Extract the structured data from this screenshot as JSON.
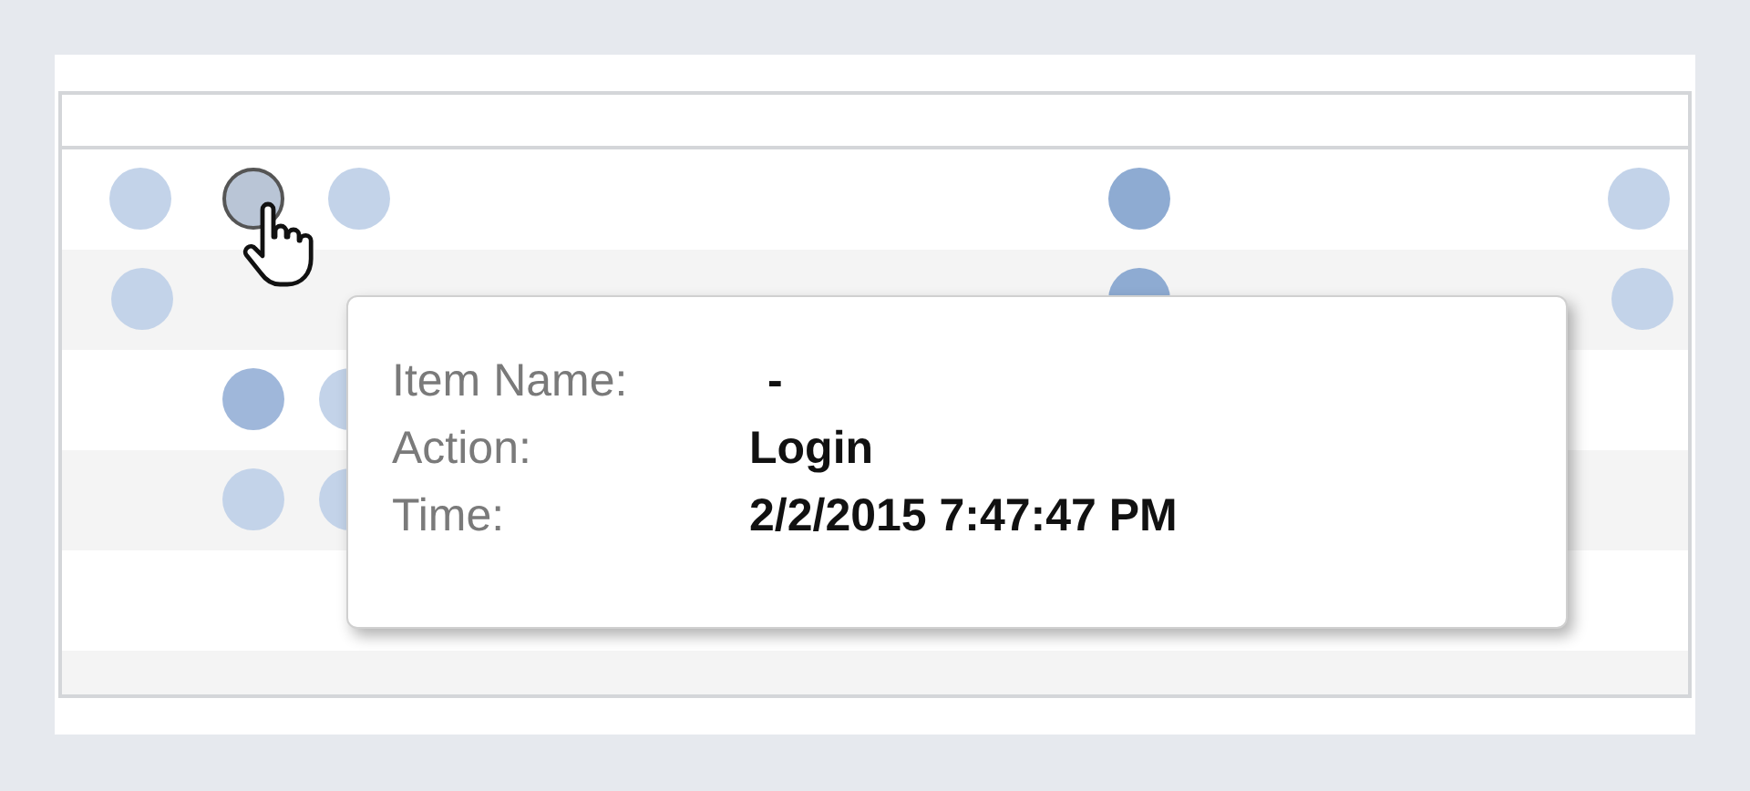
{
  "rows": [
    {
      "dots": [
        {
          "color": "#c3d3e9",
          "selected": false
        },
        {
          "color": "#b9c5d6",
          "selected": true
        },
        {
          "color": "#c3d3e9",
          "selected": false
        },
        {
          "color": "#8eabd2",
          "selected": false
        },
        {
          "color": "#c3d3e9",
          "selected": false
        }
      ]
    },
    {
      "dots": [
        {
          "color": "#c3d3e9",
          "selected": false
        },
        {
          "color": "#8eabd2",
          "selected": false
        },
        {
          "color": "#c3d3e9",
          "selected": false
        }
      ]
    },
    {
      "dots": [
        {
          "color": "#9fb7da",
          "selected": false
        },
        {
          "color": "#c3d3e9",
          "selected": false
        }
      ]
    },
    {
      "dots": [
        {
          "color": "#c3d3e9",
          "selected": false
        },
        {
          "color": "#c3d3e9",
          "selected": false
        }
      ]
    }
  ],
  "tooltip": {
    "fields": [
      {
        "label": "Item Name:",
        "value": "-"
      },
      {
        "label": "Action:",
        "value": "Login"
      },
      {
        "label": "Time:",
        "value": "2/2/2015 7:47:47 PM"
      }
    ]
  }
}
